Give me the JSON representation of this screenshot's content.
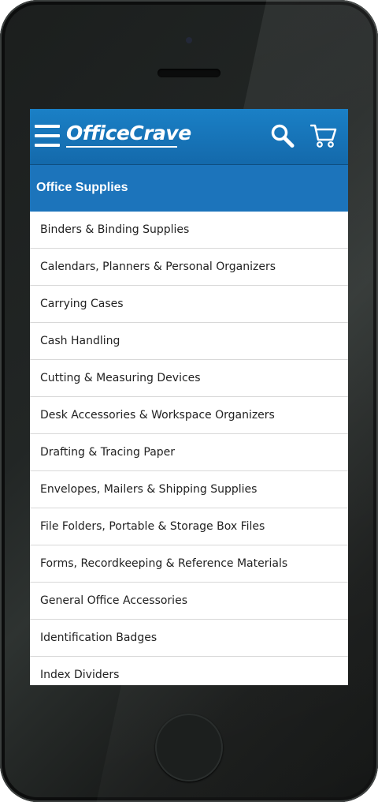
{
  "header": {
    "logo_text": "OfficeCrave",
    "colors": {
      "header_blue": "#1a80c6",
      "category_blue": "#1c74bb"
    },
    "icons": [
      "menu-icon",
      "search-icon",
      "cart-icon"
    ]
  },
  "category": {
    "title": "Office Supplies"
  },
  "list": {
    "items": [
      "Binders & Binding Supplies",
      "Calendars, Planners & Personal Organizers",
      "Carrying Cases",
      "Cash Handling",
      "Cutting & Measuring Devices",
      "Desk Accessories & Workspace Organizers",
      "Drafting & Tracing Paper",
      "Envelopes, Mailers & Shipping Supplies",
      "File Folders, Portable & Storage Box Files",
      "Forms, Recordkeeping & Reference Materials",
      "General Office Accessories",
      "Identification Badges",
      "Index Dividers"
    ]
  }
}
